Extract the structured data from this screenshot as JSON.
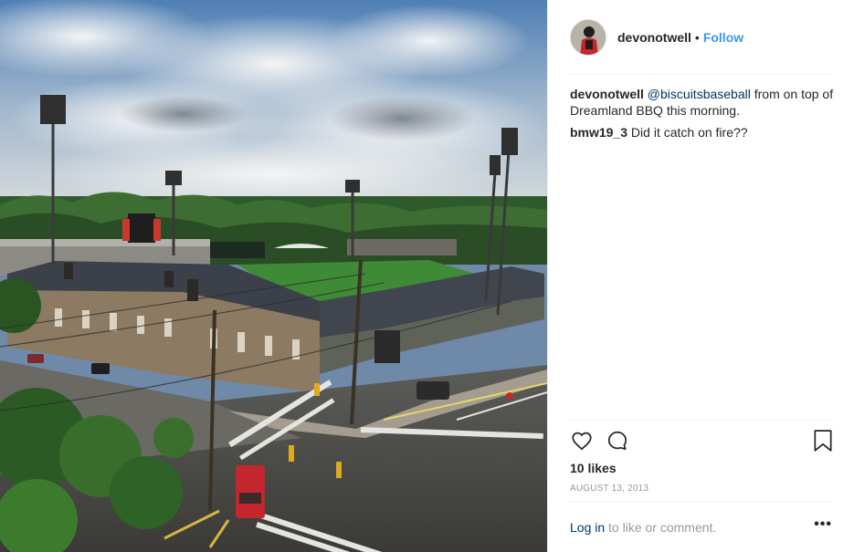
{
  "post": {
    "author": "devonotwell",
    "separator": "•",
    "follow_label": "Follow",
    "comments": [
      {
        "user": "devonotwell",
        "mention": "@biscuitsbaseball",
        "text": " from on top of Dreamland BBQ this morning."
      },
      {
        "user": "bmw19_3",
        "mention": "",
        "text": " Did it catch on fire??"
      }
    ],
    "likes": "10 likes",
    "date": "AUGUST 13, 2013",
    "footer": {
      "login_label": "Log in",
      "rest_text": " to like or comment.",
      "more_label": "•••"
    }
  },
  "icons": {
    "like": "heart-icon",
    "comment": "comment-icon",
    "save": "bookmark-icon",
    "options": "more-options-icon"
  },
  "colors": {
    "follow": "#3897f0",
    "mention": "#003569",
    "text": "#262626",
    "muted": "#999999"
  }
}
